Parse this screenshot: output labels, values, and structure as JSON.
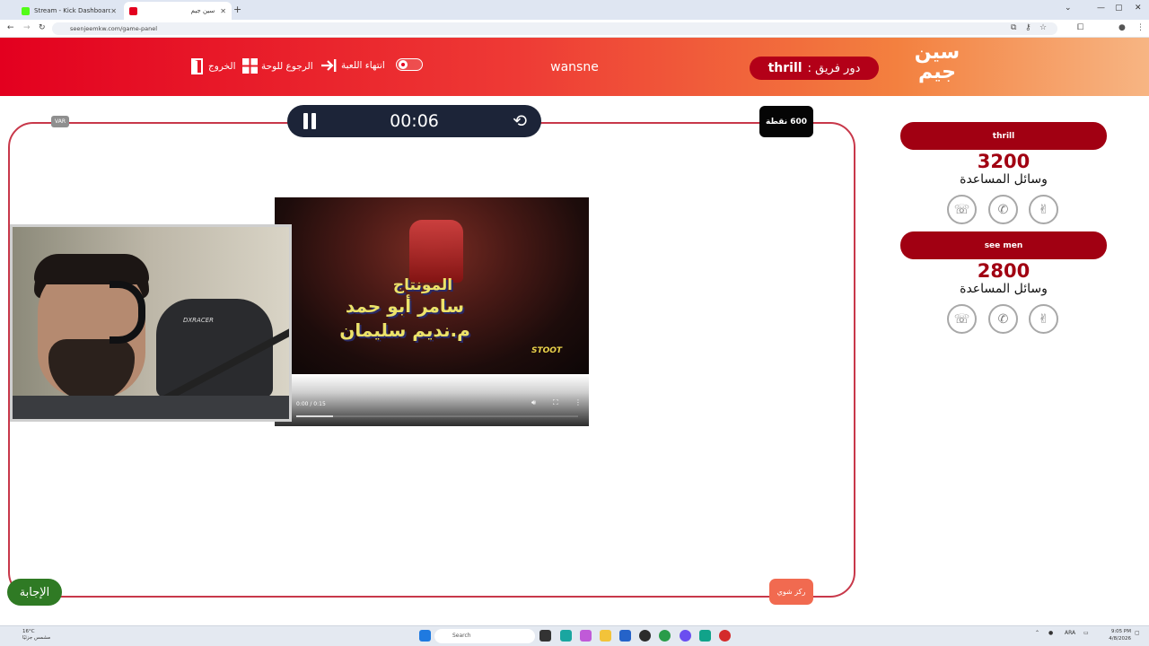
{
  "browser": {
    "tabs": [
      {
        "label": "Stream - Kick Dashboard",
        "active": false,
        "favicon_color": "#53fc18"
      },
      {
        "label": "سين جيم",
        "active": true,
        "favicon_color": "#e3001f"
      }
    ],
    "url": "seenjeemkw.com/game-panel"
  },
  "header": {
    "logo_line1": "سين",
    "logo_line2": "جيم",
    "turn_label": "دور فريق :",
    "turn_team": "thrill",
    "username": "wansne",
    "end_game_label": "انتهاء اللعبة",
    "back_to_board_label": "الرجوع للوحة",
    "exit_label": "الخروج",
    "accent": "#e3001f"
  },
  "game": {
    "timer": "00:06",
    "points_badge": "600 نقطة",
    "small_logo": "VAR",
    "answer_label": "الإجابة",
    "focus_label": "ركز شوي",
    "video": {
      "time_display": "0:00 / 0:15",
      "progress": 0.13,
      "credit_line1": "المونتاج",
      "credit_line2": "سامر أبو حمد",
      "credit_line3": "م.نديم سليمان",
      "brand": "STOOT"
    },
    "webcam": {
      "chair_brand": "DXRACER"
    }
  },
  "teams": [
    {
      "name": "thrill",
      "score": "3200",
      "aids_label": "وسائل المساعدة"
    },
    {
      "name": "see men",
      "score": "2800",
      "aids_label": "وسائل المساعدة"
    }
  ],
  "taskbar": {
    "temp": "16°C",
    "weather": "مشمس جزئيًا",
    "search_placeholder": "Search",
    "lang": "ARA",
    "time": "9:05 PM",
    "date": "4/8/2026"
  }
}
